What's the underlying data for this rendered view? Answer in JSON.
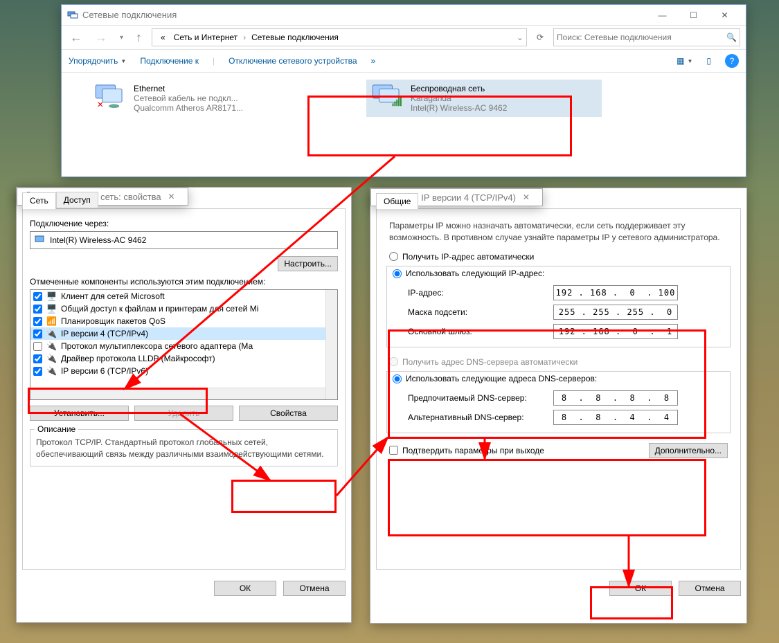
{
  "explorer": {
    "title": "Сетевые подключения",
    "breadcrumb": {
      "prefix": "«",
      "seg1": "Сеть и Интернет",
      "seg2": "Сетевые подключения"
    },
    "searchPlaceholder": "Поиск: Сетевые подключения",
    "toolbar": {
      "organize": "Упорядочить",
      "connectTo": "Подключение к",
      "disableDevice": "Отключение сетевого устройства",
      "more": "»"
    },
    "connections": [
      {
        "name": "Ethernet",
        "status": "Сетевой кабель не подкл...",
        "adapter": "Qualcomm Atheros AR8171..."
      },
      {
        "name": "Беспроводная сеть",
        "status": "Karaganda",
        "adapter": "Intel(R) Wireless-AC 9462"
      }
    ]
  },
  "propsDlg": {
    "title": "Беспроводная сеть: свойства",
    "tabs": {
      "network": "Сеть",
      "access": "Доступ"
    },
    "connectVia": "Подключение через:",
    "adapterName": "Intel(R) Wireless-AC 9462",
    "configure": "Настроить...",
    "componentsLabel": "Отмеченные компоненты используются этим подключением:",
    "components": [
      {
        "checked": true,
        "name": "Клиент для сетей Microsoft"
      },
      {
        "checked": true,
        "name": "Общий доступ к файлам и принтерам для сетей Mi"
      },
      {
        "checked": true,
        "name": "Планировщик пакетов QoS"
      },
      {
        "checked": true,
        "name": "IP версии 4 (TCP/IPv4)"
      },
      {
        "checked": false,
        "name": "Протокол мультиплексора сетевого адаптера (Ма"
      },
      {
        "checked": true,
        "name": "Драйвер протокола LLDP (Майкрософт)"
      },
      {
        "checked": true,
        "name": "IP версии 6 (TCP/IPv6)"
      }
    ],
    "btnInstall": "Установить...",
    "btnRemove": "Удалить",
    "btnProps": "Свойства",
    "descLegend": "Описание",
    "desc": "Протокол TCP/IP. Стандартный протокол глобальных сетей, обеспечивающий связь между различными взаимодействующими сетями.",
    "ok": "ОК",
    "cancel": "Отмена"
  },
  "ipv4Dlg": {
    "title": "Свойства: IP версии 4 (TCP/IPv4)",
    "tab": "Общие",
    "intro": "Параметры IP можно назначать автоматически, если сеть поддерживает эту возможность. В противном случае узнайте параметры IP у сетевого администратора.",
    "rAuto": "Получить IP-адрес автоматически",
    "rManual": "Использовать следующий IP-адрес:",
    "ipAddr": "IP-адрес:",
    "ipAddrV": "192 . 168 .  0  . 100",
    "mask": "Маска подсети:",
    "maskV": "255 . 255 . 255 .  0",
    "gw": "Основной шлюз:",
    "gwV": "192 . 168 .  0  .  1",
    "rDnsAuto": "Получить адрес DNS-сервера автоматически",
    "rDnsManual": "Использовать следующие адреса DNS-серверов:",
    "dns1": "Предпочитаемый DNS-сервер:",
    "dns1V": "8  .  8  .  8  .  8",
    "dns2": "Альтернативный DNS-сервер:",
    "dns2V": "8  .  8  .  4  .  4",
    "confirm": "Подтвердить параметры при выходе",
    "advanced": "Дополнительно...",
    "ok": "ОК",
    "cancel": "Отмена"
  }
}
